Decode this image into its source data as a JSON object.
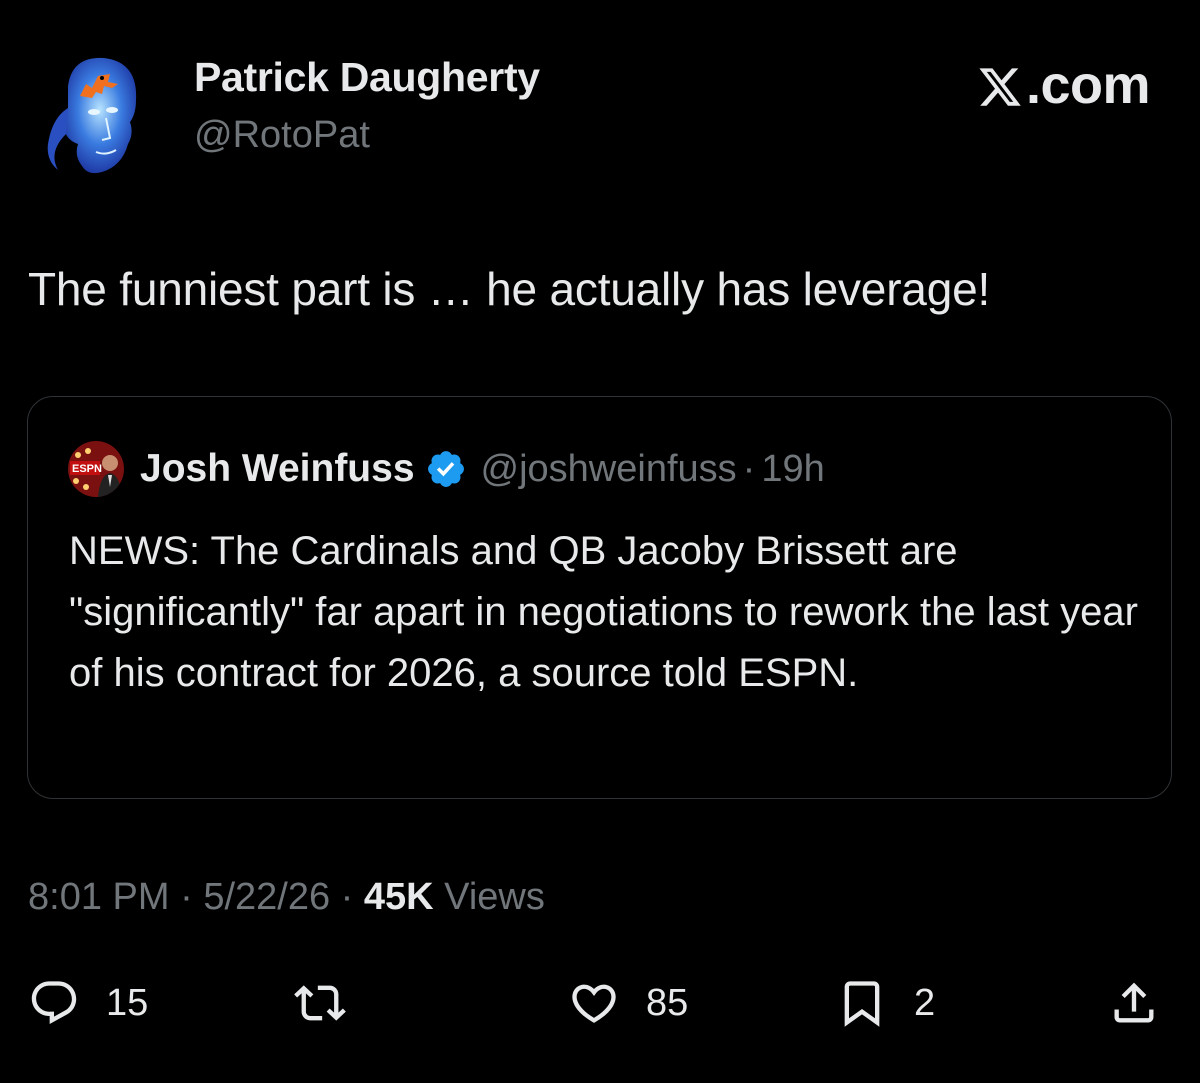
{
  "author": {
    "name": "Patrick Daugherty",
    "handle": "@RotoPat",
    "avatar_icon": "blue-head-with-orange-dinosaur-avatar"
  },
  "brand": {
    "label": ".com",
    "logo_icon": "x-logo-icon"
  },
  "tweet": {
    "text": "The funniest part is … he actually has leverage!"
  },
  "quote": {
    "avatar_icon": "espn-avatar",
    "name": "Josh Weinfuss",
    "verified_icon": "verified-badge-icon",
    "handle": "@joshweinfuss",
    "separator": "·",
    "time": "19h",
    "body": "NEWS: The Cardinals and QB Jacoby Brissett are \"significantly\" far apart in negotiations to rework the last year of his contract for 2026, a source told ESPN."
  },
  "meta": {
    "time": "8:01 PM",
    "sep1": " · ",
    "date": "5/22/26",
    "sep2": " · ",
    "views_count": "45K",
    "views_label": " Views"
  },
  "actions": {
    "reply": {
      "icon": "reply-icon",
      "count": "15"
    },
    "retweet": {
      "icon": "retweet-icon",
      "count": ""
    },
    "like": {
      "icon": "heart-icon",
      "count": "85"
    },
    "bookmark": {
      "icon": "bookmark-icon",
      "count": "2"
    },
    "share": {
      "icon": "share-icon"
    }
  },
  "colors": {
    "background": "#000000",
    "primary_text": "#e7e9ea",
    "secondary_text": "#71767b",
    "border": "#2f3336",
    "verified": "#1d9bf0"
  }
}
